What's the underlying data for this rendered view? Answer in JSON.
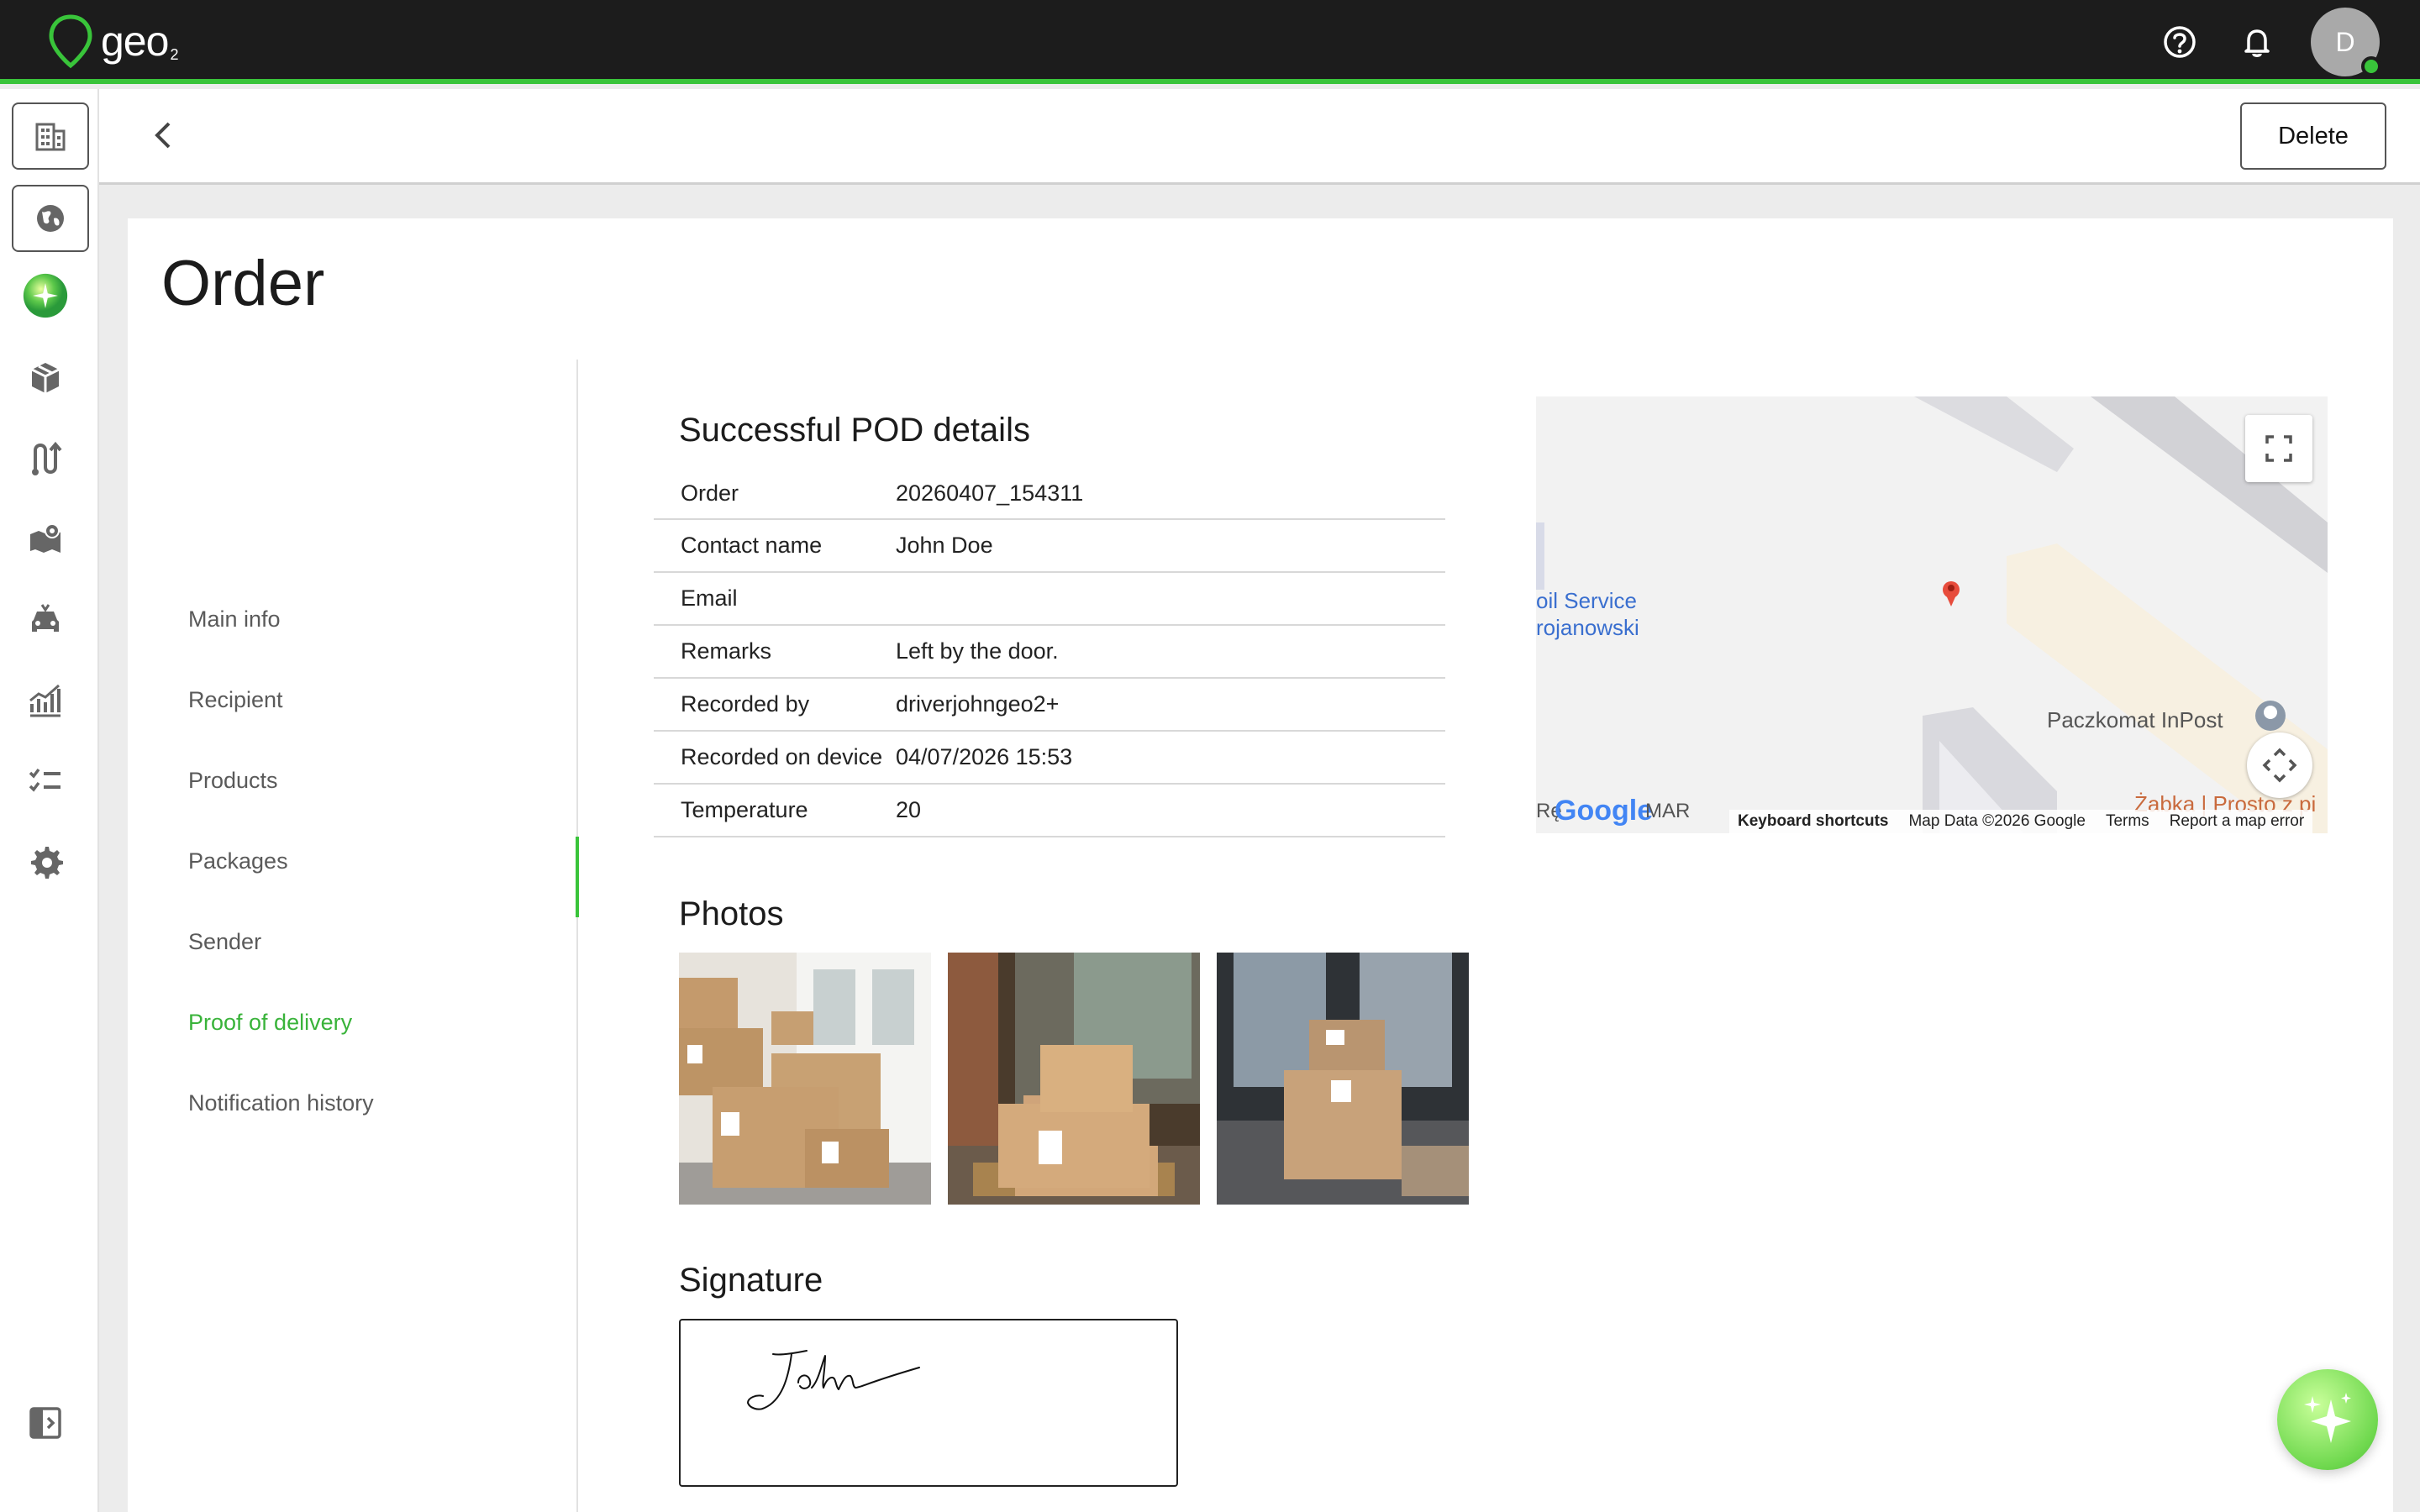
{
  "brand": {
    "name": "geo",
    "suffix": "2",
    "accent": "#39c43a"
  },
  "user": {
    "initial": "D"
  },
  "header": {
    "delete_label": "Delete"
  },
  "page": {
    "title": "Order"
  },
  "subnav": {
    "items": [
      {
        "label": "Main info",
        "active": false
      },
      {
        "label": "Recipient",
        "active": false
      },
      {
        "label": "Products",
        "active": false
      },
      {
        "label": "Packages",
        "active": false
      },
      {
        "label": "Sender",
        "active": false
      },
      {
        "label": "Proof of delivery",
        "active": true
      },
      {
        "label": "Notification history",
        "active": false
      }
    ]
  },
  "pod": {
    "title": "Successful POD details",
    "rows": [
      {
        "key": "Order",
        "value": "20260407_154311"
      },
      {
        "key": "Contact name",
        "value": "John Doe"
      },
      {
        "key": "Email",
        "value": ""
      },
      {
        "key": "Remarks",
        "value": "Left by the door."
      },
      {
        "key": "Recorded by",
        "value": "driverjohngeo2+"
      },
      {
        "key": "Recorded on device",
        "value": "04/07/2026 15:53"
      },
      {
        "key": "Temperature",
        "value": "20"
      }
    ]
  },
  "map": {
    "labels": {
      "service": "oil Service",
      "service2": "rojanowski",
      "paczkomat": "Paczkomat InPost",
      "zabka": "Żabka | Prosto z pi",
      "left_text": "Rę",
      "google": "Google",
      "mar": "MAR"
    },
    "footer": {
      "shortcuts": "Keyboard shortcuts",
      "data": "Map Data ©2026 Google",
      "terms": "Terms",
      "report": "Report a map error"
    }
  },
  "photos": {
    "title": "Photos",
    "count": 3
  },
  "signature": {
    "title": "Signature"
  }
}
